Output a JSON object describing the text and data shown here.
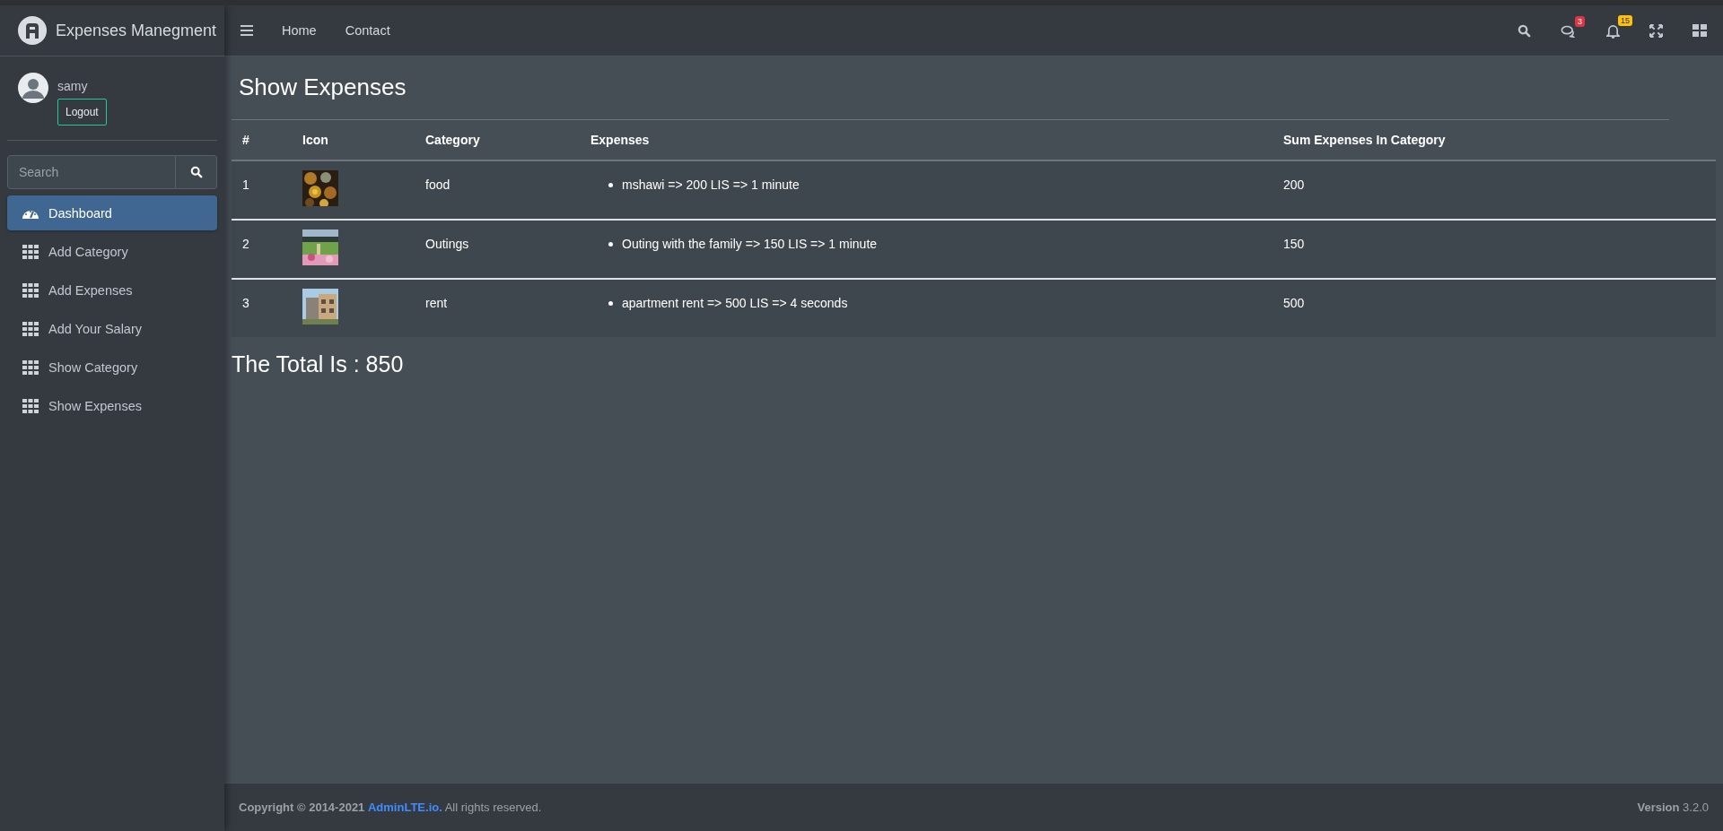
{
  "brand": {
    "title": "Expenses Manegment"
  },
  "navbar": {
    "links": [
      "Home",
      "Contact"
    ],
    "badges": [
      {
        "text": "3",
        "color": "#dc3545"
      },
      {
        "text": "15",
        "color": "#ffc107"
      }
    ]
  },
  "user": {
    "name": "samy",
    "logout": "Logout"
  },
  "sidebar": {
    "search": {
      "placeholder": "Search"
    },
    "items": [
      {
        "label": "Dashboard",
        "selected": true
      },
      {
        "label": "Add Category",
        "selected": false
      },
      {
        "label": "Add Expenses",
        "selected": false
      },
      {
        "label": "Add Your Salary",
        "selected": false
      },
      {
        "label": "Show Category",
        "selected": false
      },
      {
        "label": "Show Expenses",
        "selected": false
      }
    ]
  },
  "page": {
    "title": "Show Expenses"
  },
  "table": {
    "columns": [
      "#",
      "Icon",
      "Category",
      "Expenses",
      "Sum Expenses In Category"
    ],
    "rows": [
      {
        "index": "1",
        "category": "food",
        "expenses": [
          "mshawi => 200 LIS => 1 minute"
        ],
        "sum": "200"
      },
      {
        "index": "2",
        "category": "Outings",
        "expenses": [
          "Outing with the family => 150 LIS => 1 minute"
        ],
        "sum": "150"
      },
      {
        "index": "3",
        "category": "rent",
        "expenses": [
          "apartment rent => 500 LIS => 4 seconds"
        ],
        "sum": "500"
      }
    ]
  },
  "total": "The Total Is : 850",
  "footer": {
    "copyright": "Copyright © 2014-2021",
    "link": "AdminLTE.io.",
    "rights": "All rights reserved.",
    "version": "**Version** 3.2.0"
  }
}
